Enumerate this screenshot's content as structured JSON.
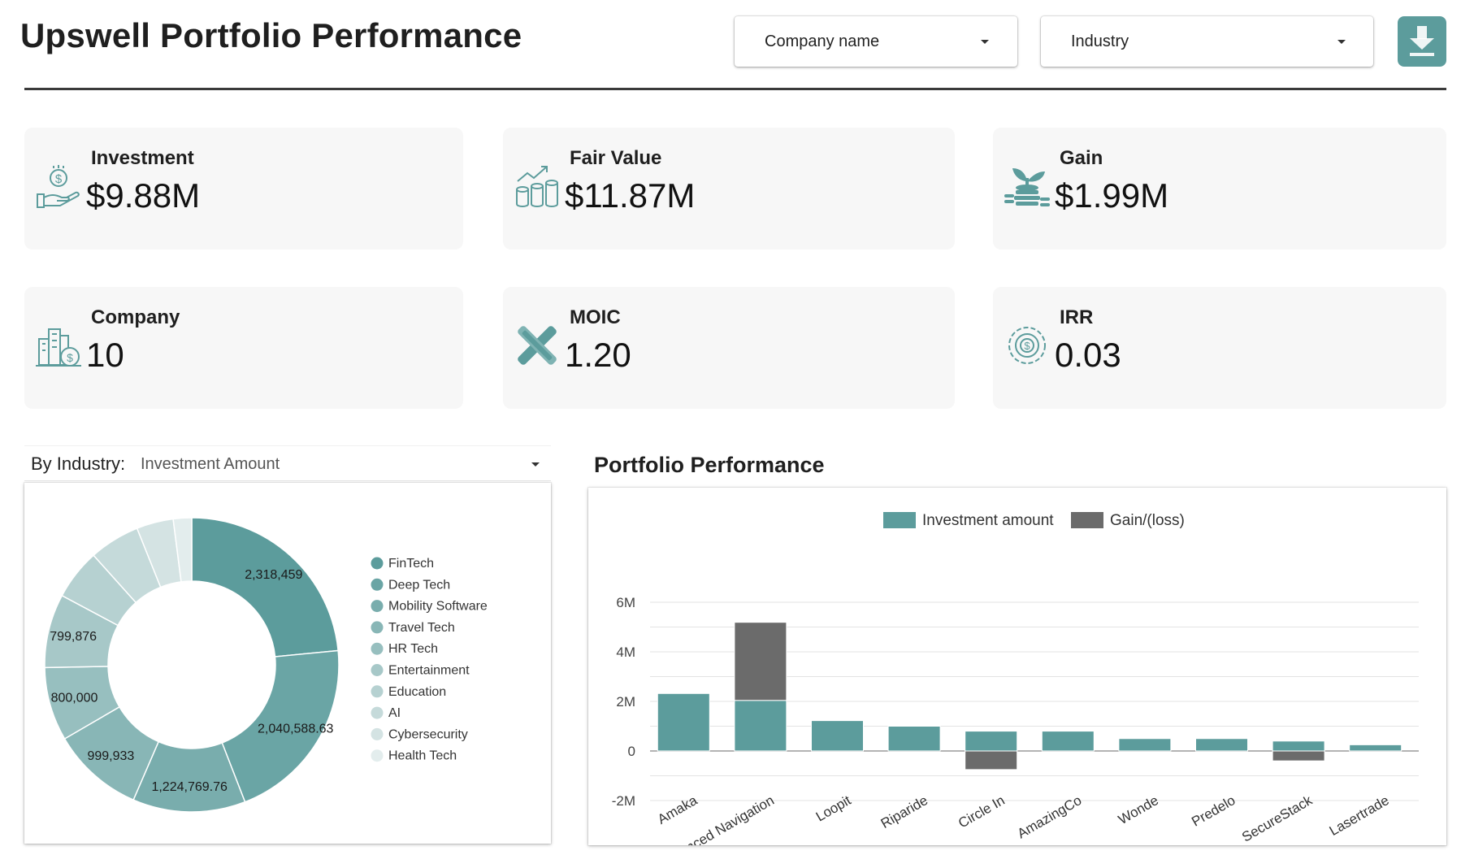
{
  "header": {
    "title": "Upswell Portfolio Performance",
    "filters": [
      {
        "label": "Company name"
      },
      {
        "label": "Industry"
      }
    ],
    "download_icon": "download-icon"
  },
  "kpis": [
    {
      "label": "Investment",
      "value": "$9.88M",
      "icon": "money-hand-icon"
    },
    {
      "label": "Fair Value",
      "value": "$11.87M",
      "icon": "growth-coins-icon"
    },
    {
      "label": "Gain",
      "value": "$1.99M",
      "icon": "sprout-coins-icon"
    },
    {
      "label": "Company",
      "value": "10",
      "icon": "buildings-icon"
    },
    {
      "label": "MOIC",
      "value": "1.20",
      "icon": "cross-tools-icon"
    },
    {
      "label": "IRR",
      "value": "0.03",
      "icon": "dollar-cycle-icon"
    }
  ],
  "colors": {
    "accent": "#5c9c9c",
    "gain": "#6b6b6b",
    "kpi_icon": "#5c9c9c"
  },
  "pie_panel": {
    "dimension_label": "By Industry:",
    "metric_label": "Investment Amount"
  },
  "bar_panel": {
    "title": "Portfolio Performance"
  },
  "chart_data": [
    {
      "type": "pie",
      "donut": true,
      "legend_position": "right",
      "categories": [
        "FinTech",
        "Deep Tech",
        "Mobility Software",
        "Travel Tech",
        "HR Tech",
        "Entertainment",
        "Education",
        "AI",
        "Cybersecurity",
        "Health Tech"
      ],
      "values": [
        2318459,
        2040588.63,
        1224769.76,
        999933,
        800000,
        799876,
        550000,
        550000,
        400000,
        200000
      ],
      "data_labels": [
        "2,318,459",
        "2,040,588.63",
        "1,224,769.76",
        "999,933",
        "800,000",
        "799,876",
        "",
        "",
        "",
        ""
      ],
      "colors": [
        "#5c9c9c",
        "#6aa5a5",
        "#79adad",
        "#88b6b6",
        "#97bfbf",
        "#a7c8c8",
        "#b6d1d1",
        "#c5dada",
        "#d4e3e3",
        "#e3eded"
      ]
    },
    {
      "type": "bar",
      "stacked": true,
      "legend_position": "top",
      "categories": [
        "Amaka",
        "Advanced Navigation",
        "Loopit",
        "Riparide",
        "Circle In",
        "AmazingCo",
        "Wonde",
        "Predelo",
        "SecureStack",
        "Lasertrade"
      ],
      "series": [
        {
          "name": "Investment amount",
          "color": "#5c9c9c",
          "values": [
            2318459,
            2040588.63,
            1224769.76,
            999933,
            800000,
            799876,
            500000,
            500000,
            400000,
            250000
          ]
        },
        {
          "name": "Gain/(loss)",
          "color": "#6b6b6b",
          "values": [
            0,
            3150000,
            0,
            0,
            -750000,
            0,
            0,
            0,
            -400000,
            0
          ]
        }
      ],
      "y_ticks": [
        "6M",
        "4M",
        "2M",
        "0",
        "-2M"
      ],
      "ylim": [
        -2000000,
        6000000
      ],
      "grid": true
    }
  ]
}
